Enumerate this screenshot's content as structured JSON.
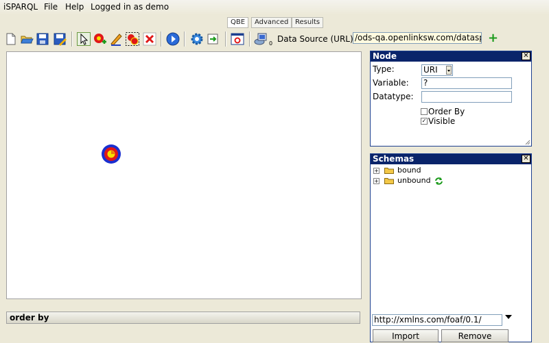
{
  "menu": {
    "app": "iSPARQL",
    "file": "File",
    "help": "Help",
    "login": "Logged in as demo"
  },
  "tabs": [
    {
      "label": "QBE"
    },
    {
      "label": "Advanced"
    },
    {
      "label": "Results"
    }
  ],
  "toolbar": {
    "datasource_label": "Data Source (URL):",
    "datasource_value": "/ods-qa.openlinksw.com/dataspace",
    "counter": "0",
    "add_icon": "+"
  },
  "orderby": {
    "label": "order by"
  },
  "node_panel": {
    "title": "Node",
    "type_label": "Type:",
    "type_value": "URI",
    "variable_label": "Variable:",
    "variable_value": "?",
    "datatype_label": "Datatype:",
    "datatype_value": "",
    "orderby_label": "Order By",
    "visible_label": "Visible",
    "visible_check": "✓"
  },
  "schemas_panel": {
    "title": "Schemas",
    "items": [
      {
        "label": "bound"
      },
      {
        "label": "unbound"
      }
    ],
    "namespace_value": "http://xmlns.com/foaf/0.1/",
    "import_label": "Import",
    "remove_label": "Remove"
  },
  "close_icon": "✕",
  "expander_icon": "+",
  "colors": {
    "title_bar": "#0a246a",
    "node_outer": "#1a2fd0",
    "node_middle": "#e01818",
    "node_inner": "#f7e000",
    "add_green": "#1a9a1a"
  }
}
